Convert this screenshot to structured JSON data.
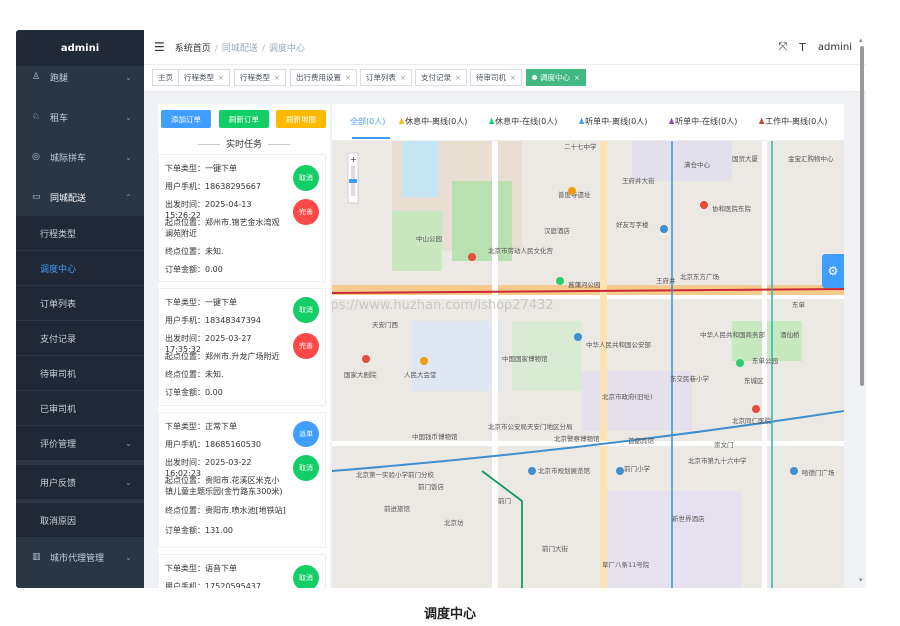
{
  "sidebar": {
    "brand": "admini",
    "items": [
      {
        "label": "跑腿",
        "icon": "person-run-icon",
        "has_chevron": true
      },
      {
        "label": "租车",
        "icon": "car-icon",
        "has_chevron": true
      },
      {
        "label": "城际拼车",
        "icon": "location-icon",
        "has_chevron": true
      },
      {
        "label": "同城配送",
        "icon": "truck-icon",
        "has_chevron": true,
        "expanded": true
      },
      {
        "label": "城市代理管理",
        "icon": "building-icon",
        "has_chevron": true
      }
    ],
    "sub_items": [
      {
        "label": "行程类型"
      },
      {
        "label": "调度中心",
        "active": true
      },
      {
        "label": "订单列表"
      },
      {
        "label": "支付记录"
      },
      {
        "label": "待审司机"
      },
      {
        "label": "已审司机"
      },
      {
        "label": "评价管理",
        "has_chevron": true
      },
      {
        "label": "用户反馈",
        "has_chevron": true
      },
      {
        "label": "取消原因"
      }
    ]
  },
  "header": {
    "breadcrumb": [
      "系统首页",
      "同城配送",
      "调度中心"
    ],
    "user": "admini"
  },
  "tags": [
    {
      "label": "主页",
      "closable": false
    },
    {
      "label": "行程类型",
      "closable": true
    },
    {
      "label": "行程类型",
      "closable": true
    },
    {
      "label": "出行费用设置",
      "closable": true
    },
    {
      "label": "订单列表",
      "closable": true
    },
    {
      "label": "支付记录",
      "closable": true
    },
    {
      "label": "待审司机",
      "closable": true
    },
    {
      "label": "调度中心",
      "closable": true,
      "active": true
    }
  ],
  "buttons": {
    "add": "添加订单",
    "refresh_orders": "刷新订单",
    "refresh_map": "刷新地图"
  },
  "panel_title": "实时任务",
  "field_labels": {
    "type": "下单类型：",
    "phone": "用户手机：",
    "time": "出发时间：",
    "start": "起点位置：",
    "end": "终点位置：",
    "amount": "订单金额："
  },
  "orders": [
    {
      "type": "一键下单",
      "phone": "18638295667",
      "time": "2025-04-13 15:26:22",
      "start": "郑州市.锦艺金水湾观澜苑附近",
      "end": "未知.",
      "amount": "0.00",
      "actions": [
        "取消",
        "完善"
      ]
    },
    {
      "type": "一键下单",
      "phone": "18348347394",
      "time": "2025-03-27 17:35:32",
      "start": "郑州市.升龙广场附近",
      "end": "未知.",
      "amount": "0.00",
      "actions": [
        "取消",
        "完善"
      ]
    },
    {
      "type": "正常下单",
      "phone": "18685160530",
      "time": "2025-03-22 16:02:23",
      "start": "贵阳市.花溪区米克小镇儿童主题乐园(金竹路东300米)",
      "end": "贵阳市.喷水池[地铁站]",
      "amount": "131.00",
      "actions": [
        "派单",
        "取消"
      ]
    },
    {
      "type": "语音下单",
      "phone": "17520595437",
      "actions": [
        "取消"
      ]
    }
  ],
  "filters": [
    "全部(0人)",
    "休息中-离线(0人)",
    "休息中-在线(0人)",
    "听单中-离线(0人)",
    "听单中-在线(0人)",
    "工作中-离线(0人)"
  ],
  "map_labels": {
    "l1": "二十七中学",
    "l2": "国贸大厦",
    "l3": "金宝汇购物中心",
    "l4": "满仓中心",
    "l5": "王府井大街",
    "l6": "普度寺遗址",
    "l7": "协和医院东院",
    "l8": "好友写字楼",
    "l9": "北京市劳动人民文化宫",
    "l10": "汉庭酒店",
    "l11": "王府井",
    "l12": "北京东方广场",
    "l13": "菖蒲河公园",
    "l14": "天安门西",
    "l15": "中山公园",
    "l16": "中国国家博物馆",
    "l17": "中华人民共和国公安部",
    "l18": "中华人民共和国商务部",
    "l19": "东单公园",
    "l20": "国家大剧院",
    "l21": "人民大会堂",
    "l22": "北京市政府(旧址)",
    "l23": "东交民巷小学",
    "l24": "北京同仁医院",
    "l25": "中国钱币博物馆",
    "l26": "北京市公安局天安门地区分局",
    "l27": "北京警察博物馆",
    "l28": "首都宾馆",
    "l29": "崇文门",
    "l30": "北京第一实验小学前门分校",
    "l31": "前门饭店",
    "l32": "北京市规划展览馆",
    "l33": "前门小学",
    "l34": "北京市第九十六中学",
    "l35": "哈德门广场",
    "l36": "前进旅馆",
    "l37": "北京坊",
    "l38": "前门",
    "l39": "新世界酒店",
    "l40": "前门大街",
    "l41": "草厂八条11号院",
    "l42": "东城区",
    "l43": "东单",
    "l44": "酒仙桥"
  },
  "watermark": "https://www.huzhan.com/ishop27432",
  "caption": "调度中心"
}
